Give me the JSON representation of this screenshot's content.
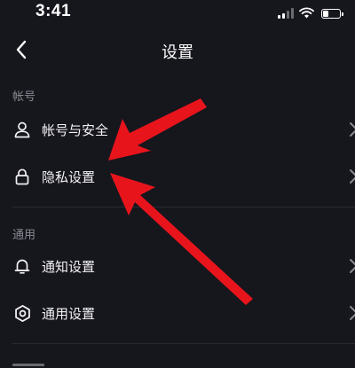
{
  "status_bar": {
    "time": "3:41",
    "battery_level": 0.35
  },
  "nav": {
    "title": "设置"
  },
  "sections": [
    {
      "header": "帐号",
      "items": [
        {
          "label": "帐号与安全",
          "icon": "person-icon"
        },
        {
          "label": "隐私设置",
          "icon": "lock-icon"
        }
      ]
    },
    {
      "header": "通用",
      "items": [
        {
          "label": "通知设置",
          "icon": "bell-icon"
        },
        {
          "label": "通用设置",
          "icon": "gear-icon"
        }
      ]
    }
  ],
  "colors": {
    "background": "#16161d",
    "text": "#f2f2f4",
    "section_header": "#8a8a94",
    "divider": "#2a2a33",
    "annotation_arrow": "#e8141c"
  }
}
